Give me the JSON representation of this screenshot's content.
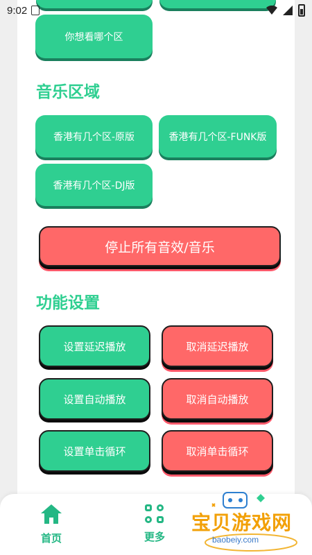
{
  "status_bar": {
    "time": "9:02"
  },
  "region_buttons": {
    "which_region": "你想看哪个区"
  },
  "music_section": {
    "title": "音乐区域",
    "original": "香港有几个区-原版",
    "funk": "香港有几个区-FUNK版",
    "dj": "香港有几个区-DJ版"
  },
  "stop_all": "停止所有音效/音乐",
  "settings_section": {
    "title": "功能设置",
    "set_delay": "设置延迟播放",
    "cancel_delay": "取消延迟播放",
    "set_auto": "设置自动播放",
    "cancel_auto": "取消自动播放",
    "set_loop": "设置单击循环",
    "cancel_loop": "取消单击循环"
  },
  "bottom_nav": {
    "home": "首页",
    "more": "更多"
  },
  "watermark": {
    "brand": "宝贝游戏网",
    "url": "baobeiy.com"
  },
  "colors": {
    "green": "#2fcf91",
    "red": "#ff6868",
    "accent_text": "#24b784"
  }
}
